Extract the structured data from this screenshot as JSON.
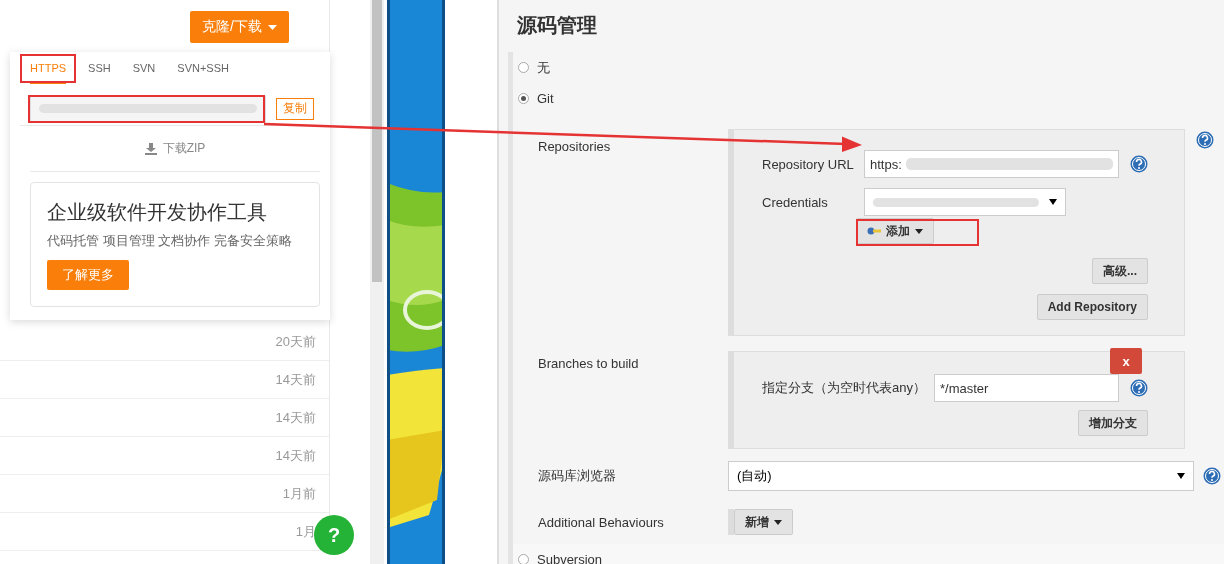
{
  "left_panel": {
    "clone_button": "克隆/下载",
    "tabs": [
      {
        "label": "HTTPS",
        "selected": true
      },
      {
        "label": "SSH",
        "selected": false
      },
      {
        "label": "SVN",
        "selected": false
      },
      {
        "label": "SVN+SSH",
        "selected": false
      }
    ],
    "copy_button": "复制",
    "download_zip": "下载ZIP",
    "promo": {
      "title": "企业级软件开发协作工具",
      "subtitle": "代码托管 项目管理 文档协作 完备安全策略",
      "button": "了解更多"
    },
    "rows": [
      {
        "time": "20天前"
      },
      {
        "time": "14天前"
      },
      {
        "time": "14天前"
      },
      {
        "time": "14天前"
      },
      {
        "time": "1月前"
      },
      {
        "time": "1月"
      }
    ],
    "help_button": "?"
  },
  "jenkins": {
    "title": "源码管理",
    "options": [
      {
        "label": "无",
        "selected": false
      },
      {
        "label": "Git",
        "selected": true
      }
    ],
    "repositories": {
      "label": "Repositories",
      "url_label": "Repository URL",
      "url_value": "https:",
      "credentials_label": "Credentials",
      "add_button": "添加",
      "advanced_button": "高级...",
      "add_repository_button": "Add Repository"
    },
    "branches": {
      "label": "Branches to build",
      "delete_button": "x",
      "spec_label": "指定分支（为空时代表any）",
      "spec_value": "*/master",
      "add_branch_button": "增加分支"
    },
    "browser": {
      "label": "源码库浏览器",
      "value": "(自动)"
    },
    "behaviours": {
      "label": "Additional Behaviours",
      "button": "新增"
    },
    "subversion": {
      "label": "Subversion",
      "selected": false
    }
  }
}
